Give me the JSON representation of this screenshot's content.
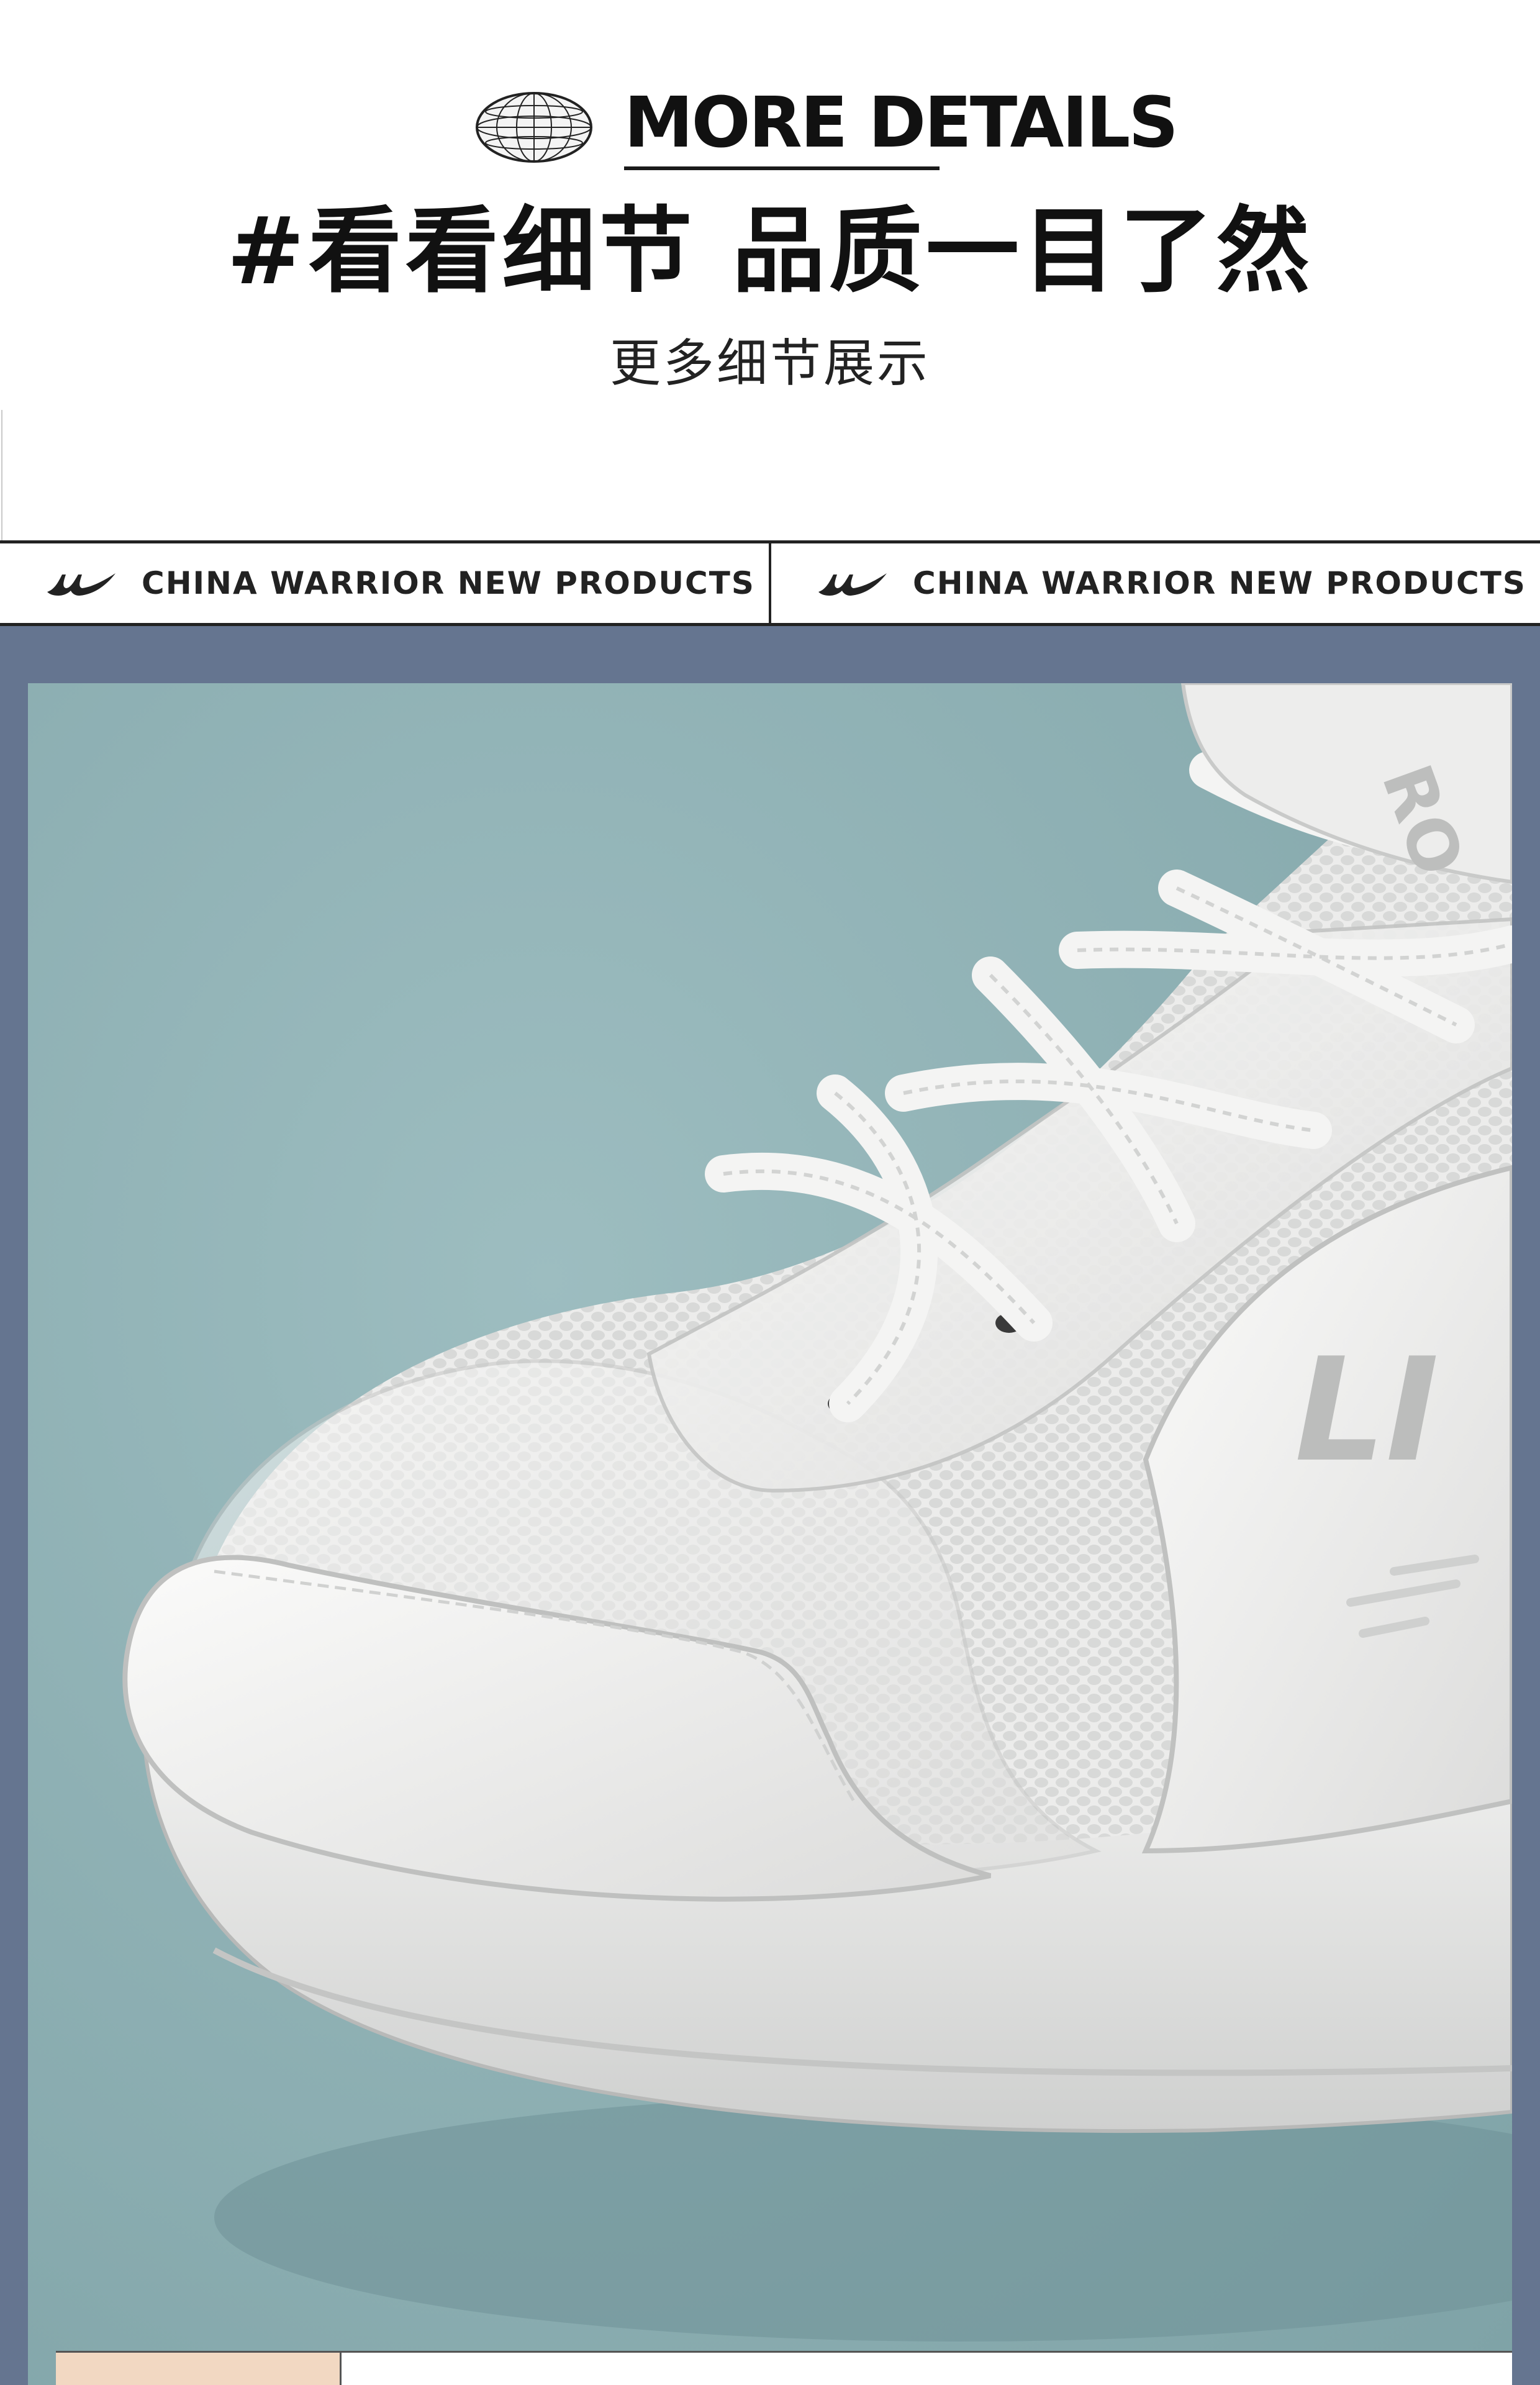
{
  "header": {
    "english_title": "MORE DETAILS",
    "chinese_headline": "#看看细节 品质一目了然",
    "chinese_subtitle": "更多细节展示"
  },
  "brand_bar": {
    "items": [
      {
        "text": "CHINA WARRIOR NEW PRODUCTS"
      },
      {
        "text": "CHINA WARRIOR NEW PRODUCTS"
      }
    ]
  },
  "photo": {
    "subject": "white sneaker close-up",
    "shoe_side_text": "LI",
    "tongue_text": "RO"
  },
  "colors": {
    "frame": "#657590",
    "photo_background": "#8aadb1",
    "text": "#111111",
    "swatch": "#f2d8c2"
  },
  "icons": [
    "globe-icon",
    "brand-logo-icon"
  ]
}
